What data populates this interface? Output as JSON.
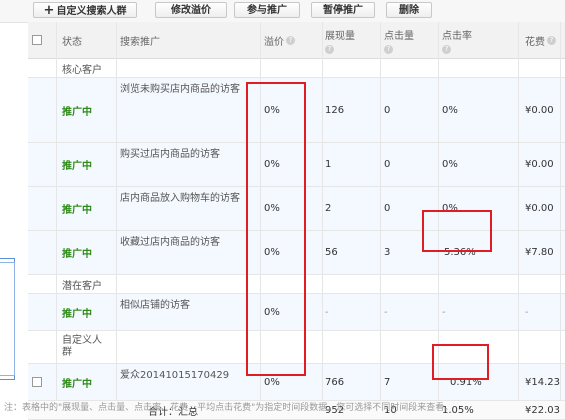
{
  "toolbar": {
    "add_label": "自定义搜索人群",
    "add_icon": "plus-icon",
    "modify_bid_label": "修改溢价",
    "join_promo_label": "参与推广",
    "pause_promo_label": "暂停推广",
    "delete_label": "删除"
  },
  "table": {
    "headers": {
      "status": "状态",
      "search_promo": "搜索推广",
      "premium": "溢价",
      "impressions": "展现量",
      "clicks": "点击量",
      "ctr": "点击率",
      "cost": "花费"
    },
    "groups": {
      "core": "核心客户",
      "potential": "潜在客户",
      "custom": "自定义人群"
    },
    "rows": [
      {
        "status": "推广中",
        "name": "浏览未购买店内商品的访客",
        "premium": "0%",
        "impressions": "126",
        "clicks": "0",
        "ctr": "0%",
        "cost": "¥0.00"
      },
      {
        "status": "推广中",
        "name": "购买过店内商品的访客",
        "premium": "0%",
        "impressions": "1",
        "clicks": "0",
        "ctr": "0%",
        "cost": "¥0.00"
      },
      {
        "status": "推广中",
        "name": "店内商品放入购物车的访客",
        "premium": "0%",
        "impressions": "2",
        "clicks": "0",
        "ctr": "0%",
        "cost": "¥0.00"
      },
      {
        "status": "推广中",
        "name": "收藏过店内商品的访客",
        "premium": "0%",
        "impressions": "56",
        "clicks": "3",
        "ctr": "5.36%",
        "cost": "¥7.80"
      },
      {
        "status": "推广中",
        "name": "相似店铺的访客",
        "premium": "0%",
        "impressions": "-",
        "clicks": "-",
        "ctr": "-",
        "cost": "-"
      },
      {
        "status": "推广中",
        "name": "爱众20141015170429",
        "premium": "0%",
        "impressions": "766",
        "clicks": "7",
        "ctr": "0.91%",
        "cost": "¥14.23"
      }
    ],
    "totals": {
      "label": "合计：汇总",
      "impressions": "952",
      "clicks": "10",
      "ctr": "1.05%",
      "cost": "¥22.03"
    }
  },
  "footer_note": "注：表格中的\"展现量、点击量、点击率、花费、平均点击花费\"为指定时间段数据，您可选择不同时间段来查看。",
  "colors": {
    "status_green": "#2e8b17",
    "highlight_red": "#e11c22",
    "row_blue": "#f4f9ff"
  }
}
